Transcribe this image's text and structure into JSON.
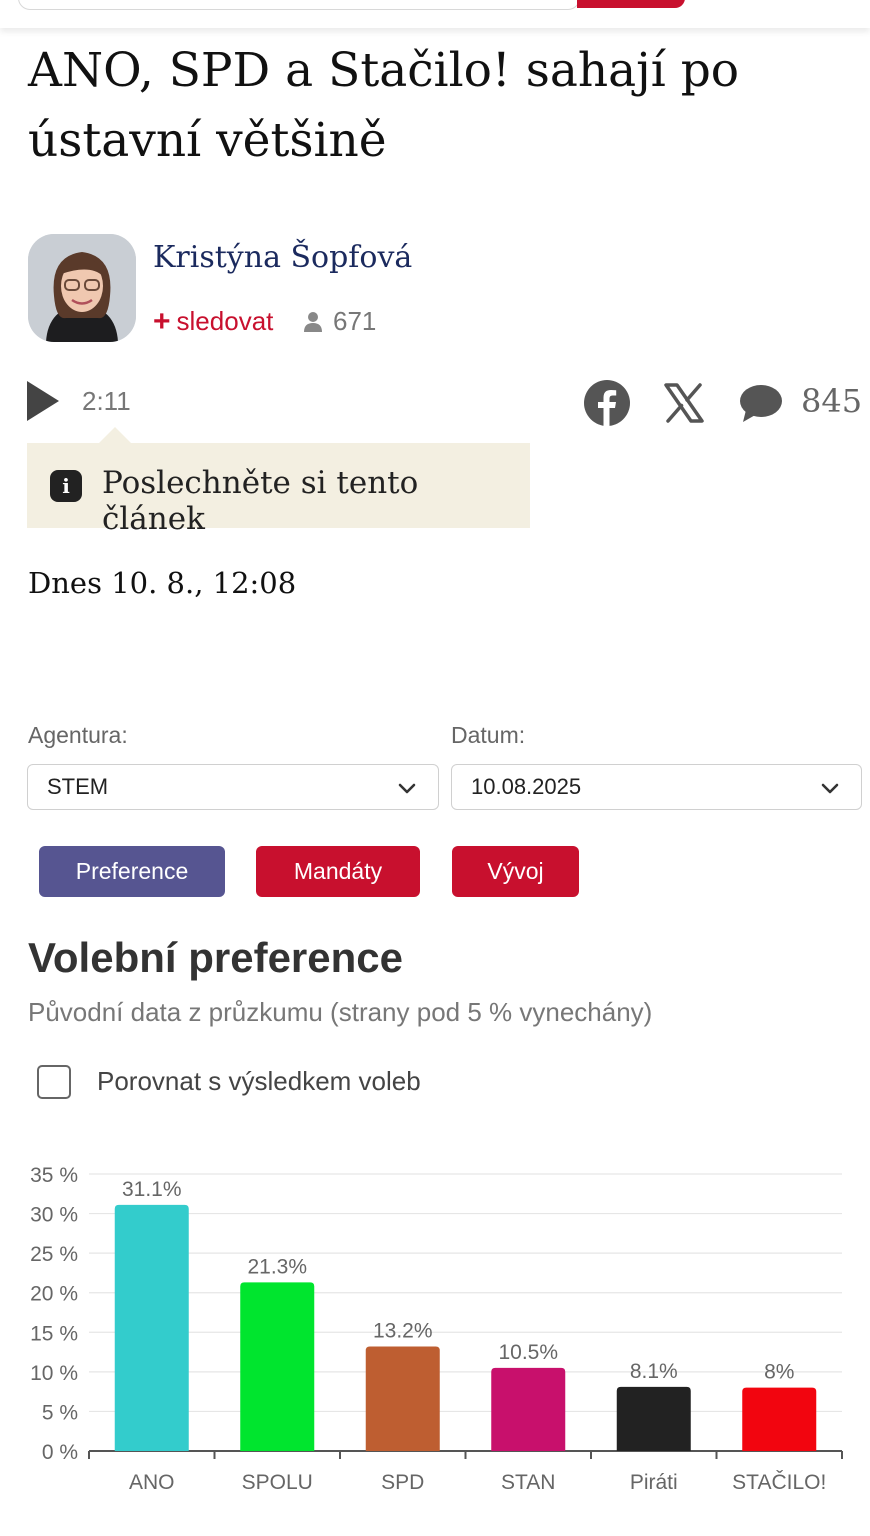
{
  "article": {
    "headline": "ANO, SPD a Stačilo! sahají po ústavní většině",
    "author": {
      "name": "Kristýna Šopfová",
      "follow_plus": "+",
      "follow_label": "sledovat",
      "followers": "671"
    },
    "audio": {
      "duration": "2:11",
      "tooltip": "Poslechněte si tento článek",
      "info_glyph": "i"
    },
    "comments_count": "845",
    "date": "Dnes 10. 8., 12:08"
  },
  "filters": {
    "agency_label": "Agentura:",
    "agency_value": "STEM",
    "date_label": "Datum:",
    "date_value": "10.08.2025"
  },
  "tabs": [
    {
      "label": "Preference",
      "color": "#565591"
    },
    {
      "label": "Mandáty",
      "color": "#c8102e"
    },
    {
      "label": "Vývoj",
      "color": "#c8102e"
    }
  ],
  "section": {
    "title": "Volební preference",
    "subtitle": "Původní data z průzkumu (strany pod 5 % vynechány)",
    "compare_label": "Porovnat s výsledkem voleb",
    "compare_checked": false
  },
  "icons": {
    "play": "play-icon",
    "facebook": "facebook-icon",
    "x": "x-twitter-icon",
    "comment": "comment-icon",
    "user": "user-icon",
    "chevron": "chevron-down-icon",
    "info": "info-icon"
  },
  "chart_data": {
    "type": "bar",
    "categories": [
      "ANO",
      "SPOLU",
      "SPD",
      "STAN",
      "Piráti",
      "STAČILO!"
    ],
    "values": [
      31.1,
      21.3,
      13.2,
      10.5,
      8.1,
      8
    ],
    "value_labels": [
      "31.1%",
      "21.3%",
      "13.2%",
      "10.5%",
      "8.1%",
      "8%"
    ],
    "colors": [
      "#33cccc",
      "#00e52e",
      "#be5e31",
      "#c8106c",
      "#222222",
      "#f2050f"
    ],
    "ylim": [
      0,
      35
    ],
    "yticks": [
      0,
      5,
      10,
      15,
      20,
      25,
      30,
      35
    ],
    "ytick_labels": [
      "0 %",
      "5 %",
      "10 %",
      "15 %",
      "20 %",
      "25 %",
      "30 %",
      "35 %"
    ],
    "grid": true
  }
}
